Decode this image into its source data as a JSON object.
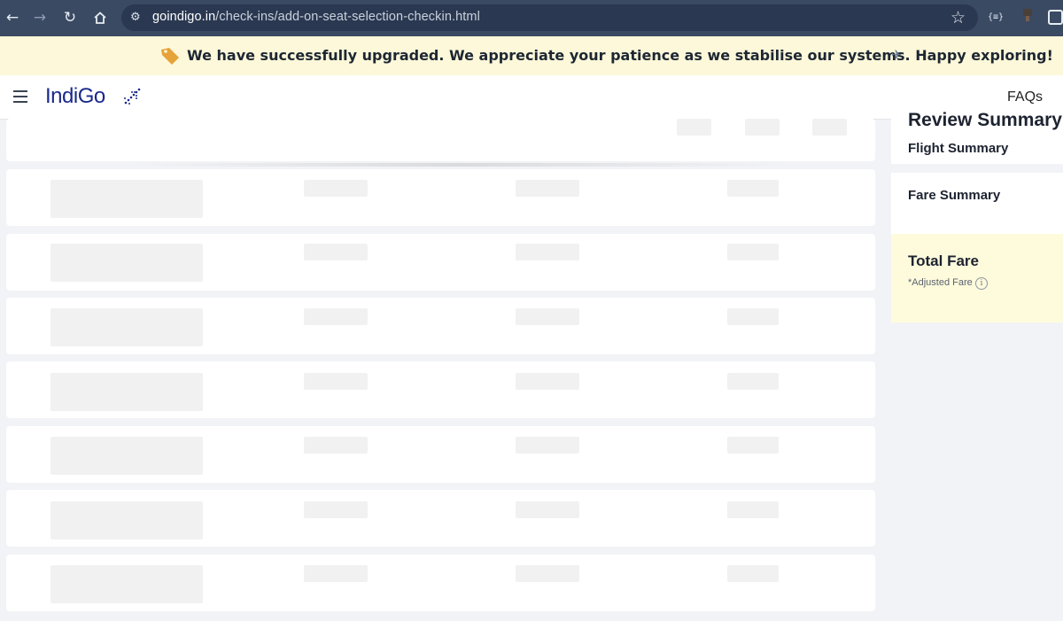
{
  "browser": {
    "url_host": "goindigo.in",
    "url_path": "/check-ins/add-on-seat-selection-checkin.html",
    "back_icon": "arrow-left-icon",
    "forward_icon": "arrow-right-icon",
    "reload_icon": "reload-icon",
    "home_icon": "home-icon",
    "bookmark_icon": "star-icon",
    "extension_label": "{≡}"
  },
  "banner": {
    "text": "We have successfully upgraded. We appreciate your patience as we stabilise our systems. Happy exploring!",
    "tag_color": "#e6a33a"
  },
  "header": {
    "logo": "IndiGo",
    "faqs": "FAQs",
    "brand_color": "#1a2a8a"
  },
  "summary": {
    "review_title": "Review Summary",
    "flight_summary": "Flight Summary",
    "fare_summary": "Fare Summary",
    "total_fare": "Total Fare",
    "adjusted_fare": "*Adjusted Fare",
    "info_glyph": "i"
  },
  "colors": {
    "page_bg": "#f2f3f6",
    "skeleton": "#f1f1f2",
    "total_bg": "#fdfbdc",
    "browser_bar": "#3a4a63"
  }
}
